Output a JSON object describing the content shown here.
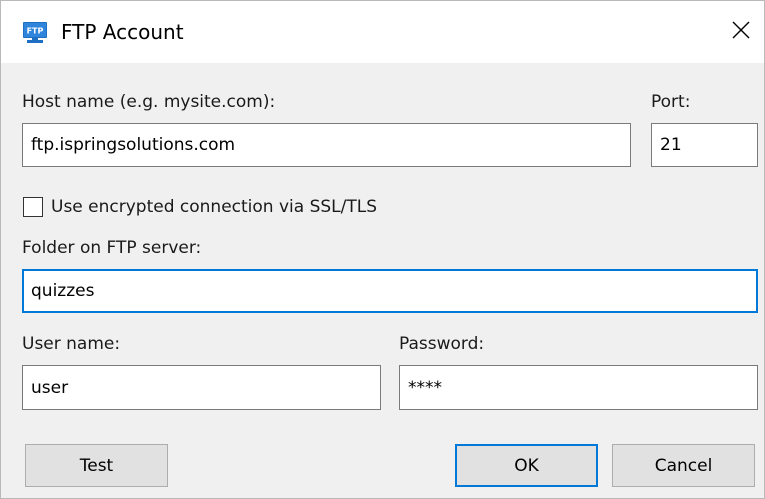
{
  "window": {
    "title": "FTP Account",
    "app_icon_text": "FTP",
    "close_glyph": "close-icon"
  },
  "form": {
    "host_label": "Host name (e.g. mysite.com):",
    "host_value": "ftp.ispringsolutions.com",
    "port_label": "Port:",
    "port_value": "21",
    "ssl_label": "Use encrypted connection via SSL/TLS",
    "ssl_checked": false,
    "folder_label": "Folder on FTP server:",
    "folder_value": "quizzes",
    "user_label": "User name:",
    "user_value": "user",
    "password_label": "Password:",
    "password_value": "****"
  },
  "buttons": {
    "test": "Test",
    "ok": "OK",
    "cancel": "Cancel"
  },
  "colors": {
    "focus_accent": "#0078d7",
    "icon_blue": "#1e6fc4"
  }
}
